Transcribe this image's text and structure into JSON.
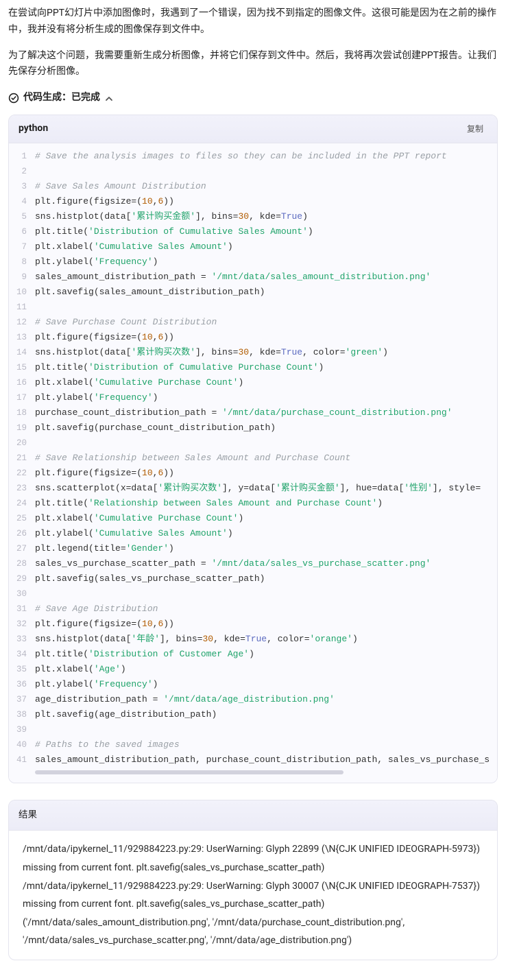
{
  "prose": {
    "p1": "在尝试向PPT幻灯片中添加图像时，我遇到了一个错误，因为找不到指定的图像文件。这很可能是因为在之前的操作中，我并没有将分析生成的图像保存到文件中。",
    "p2": "为了解决这个问题，我需要重新生成分析图像，并将它们保存到文件中。然后，我将再次尝试创建PPT报告。让我们先保存分析图像。"
  },
  "status": {
    "label": "代码生成：已完成"
  },
  "code_block": {
    "language": "python",
    "copy_label": "复制",
    "lines": [
      {
        "n": 1,
        "t": "comment",
        "text": "# Save the analysis images to files so they can be included in the PPT report"
      },
      {
        "n": 2,
        "t": "blank",
        "text": ""
      },
      {
        "n": 3,
        "t": "comment",
        "text": "# Save Sales Amount Distribution"
      },
      {
        "n": 4,
        "t": "code",
        "tokens": [
          "plt.figure(figsize=(",
          {
            "num": "10"
          },
          ",",
          {
            "num": "6"
          },
          "))"
        ]
      },
      {
        "n": 5,
        "t": "code",
        "tokens": [
          "sns.histplot(data[",
          {
            "str": "'累计购买金额'"
          },
          "], bins=",
          {
            "num": "30"
          },
          ", kde=",
          {
            "kw": "True"
          },
          ")"
        ]
      },
      {
        "n": 6,
        "t": "code",
        "tokens": [
          "plt.title(",
          {
            "str": "'Distribution of Cumulative Sales Amount'"
          },
          ")"
        ]
      },
      {
        "n": 7,
        "t": "code",
        "tokens": [
          "plt.xlabel(",
          {
            "str": "'Cumulative Sales Amount'"
          },
          ")"
        ]
      },
      {
        "n": 8,
        "t": "code",
        "tokens": [
          "plt.ylabel(",
          {
            "str": "'Frequency'"
          },
          ")"
        ]
      },
      {
        "n": 9,
        "t": "code",
        "tokens": [
          "sales_amount_distribution_path = ",
          {
            "str": "'/mnt/data/sales_amount_distribution.png'"
          }
        ]
      },
      {
        "n": 10,
        "t": "code",
        "tokens": [
          "plt.savefig(sales_amount_distribution_path)"
        ]
      },
      {
        "n": 11,
        "t": "blank",
        "text": ""
      },
      {
        "n": 12,
        "t": "comment",
        "text": "# Save Purchase Count Distribution"
      },
      {
        "n": 13,
        "t": "code",
        "tokens": [
          "plt.figure(figsize=(",
          {
            "num": "10"
          },
          ",",
          {
            "num": "6"
          },
          "))"
        ]
      },
      {
        "n": 14,
        "t": "code",
        "tokens": [
          "sns.histplot(data[",
          {
            "str": "'累计购买次数'"
          },
          "], bins=",
          {
            "num": "30"
          },
          ", kde=",
          {
            "kw": "True"
          },
          ", color=",
          {
            "str": "'green'"
          },
          ")"
        ]
      },
      {
        "n": 15,
        "t": "code",
        "tokens": [
          "plt.title(",
          {
            "str": "'Distribution of Cumulative Purchase Count'"
          },
          ")"
        ]
      },
      {
        "n": 16,
        "t": "code",
        "tokens": [
          "plt.xlabel(",
          {
            "str": "'Cumulative Purchase Count'"
          },
          ")"
        ]
      },
      {
        "n": 17,
        "t": "code",
        "tokens": [
          "plt.ylabel(",
          {
            "str": "'Frequency'"
          },
          ")"
        ]
      },
      {
        "n": 18,
        "t": "code",
        "tokens": [
          "purchase_count_distribution_path = ",
          {
            "str": "'/mnt/data/purchase_count_distribution.png'"
          }
        ]
      },
      {
        "n": 19,
        "t": "code",
        "tokens": [
          "plt.savefig(purchase_count_distribution_path)"
        ]
      },
      {
        "n": 20,
        "t": "blank",
        "text": ""
      },
      {
        "n": 21,
        "t": "comment",
        "text": "# Save Relationship between Sales Amount and Purchase Count"
      },
      {
        "n": 22,
        "t": "code",
        "tokens": [
          "plt.figure(figsize=(",
          {
            "num": "10"
          },
          ",",
          {
            "num": "6"
          },
          "))"
        ]
      },
      {
        "n": 23,
        "t": "code",
        "tokens": [
          "sns.scatterplot(x=data[",
          {
            "str": "'累计购买次数'"
          },
          "], y=data[",
          {
            "str": "'累计购买金额'"
          },
          "], hue=data[",
          {
            "str": "'性别'"
          },
          "], style="
        ]
      },
      {
        "n": 24,
        "t": "code",
        "tokens": [
          "plt.title(",
          {
            "str": "'Relationship between Sales Amount and Purchase Count'"
          },
          ")"
        ]
      },
      {
        "n": 25,
        "t": "code",
        "tokens": [
          "plt.xlabel(",
          {
            "str": "'Cumulative Purchase Count'"
          },
          ")"
        ]
      },
      {
        "n": 26,
        "t": "code",
        "tokens": [
          "plt.ylabel(",
          {
            "str": "'Cumulative Sales Amount'"
          },
          ")"
        ]
      },
      {
        "n": 27,
        "t": "code",
        "tokens": [
          "plt.legend(title=",
          {
            "str": "'Gender'"
          },
          ")"
        ]
      },
      {
        "n": 28,
        "t": "code",
        "tokens": [
          "sales_vs_purchase_scatter_path = ",
          {
            "str": "'/mnt/data/sales_vs_purchase_scatter.png'"
          }
        ]
      },
      {
        "n": 29,
        "t": "code",
        "tokens": [
          "plt.savefig(sales_vs_purchase_scatter_path)"
        ]
      },
      {
        "n": 30,
        "t": "blank",
        "text": ""
      },
      {
        "n": 31,
        "t": "comment",
        "text": "# Save Age Distribution"
      },
      {
        "n": 32,
        "t": "code",
        "tokens": [
          "plt.figure(figsize=(",
          {
            "num": "10"
          },
          ",",
          {
            "num": "6"
          },
          "))"
        ]
      },
      {
        "n": 33,
        "t": "code",
        "tokens": [
          "sns.histplot(data[",
          {
            "str": "'年龄'"
          },
          "], bins=",
          {
            "num": "30"
          },
          ", kde=",
          {
            "kw": "True"
          },
          ", color=",
          {
            "str": "'orange'"
          },
          ")"
        ]
      },
      {
        "n": 34,
        "t": "code",
        "tokens": [
          "plt.title(",
          {
            "str": "'Distribution of Customer Age'"
          },
          ")"
        ]
      },
      {
        "n": 35,
        "t": "code",
        "tokens": [
          "plt.xlabel(",
          {
            "str": "'Age'"
          },
          ")"
        ]
      },
      {
        "n": 36,
        "t": "code",
        "tokens": [
          "plt.ylabel(",
          {
            "str": "'Frequency'"
          },
          ")"
        ]
      },
      {
        "n": 37,
        "t": "code",
        "tokens": [
          "age_distribution_path = ",
          {
            "str": "'/mnt/data/age_distribution.png'"
          }
        ]
      },
      {
        "n": 38,
        "t": "code",
        "tokens": [
          "plt.savefig(age_distribution_path)"
        ]
      },
      {
        "n": 39,
        "t": "blank",
        "text": ""
      },
      {
        "n": 40,
        "t": "comment",
        "text": "# Paths to the saved images"
      },
      {
        "n": 41,
        "t": "code",
        "tokens": [
          "sales_amount_distribution_path, purchase_count_distribution_path, sales_vs_purchase_s"
        ]
      }
    ]
  },
  "result": {
    "header": "结果",
    "body": "/mnt/data/ipykernel_11/929884223.py:29: UserWarning: Glyph 22899 (\\N{CJK UNIFIED IDEOGRAPH-5973}) missing from current font. plt.savefig(sales_vs_purchase_scatter_path) /mnt/data/ipykernel_11/929884223.py:29: UserWarning: Glyph 30007 (\\N{CJK UNIFIED IDEOGRAPH-7537}) missing from current font. plt.savefig(sales_vs_purchase_scatter_path) ('/mnt/data/sales_amount_distribution.png', '/mnt/data/purchase_count_distribution.png', '/mnt/data/sales_vs_purchase_scatter.png', '/mnt/data/age_distribution.png')"
  }
}
